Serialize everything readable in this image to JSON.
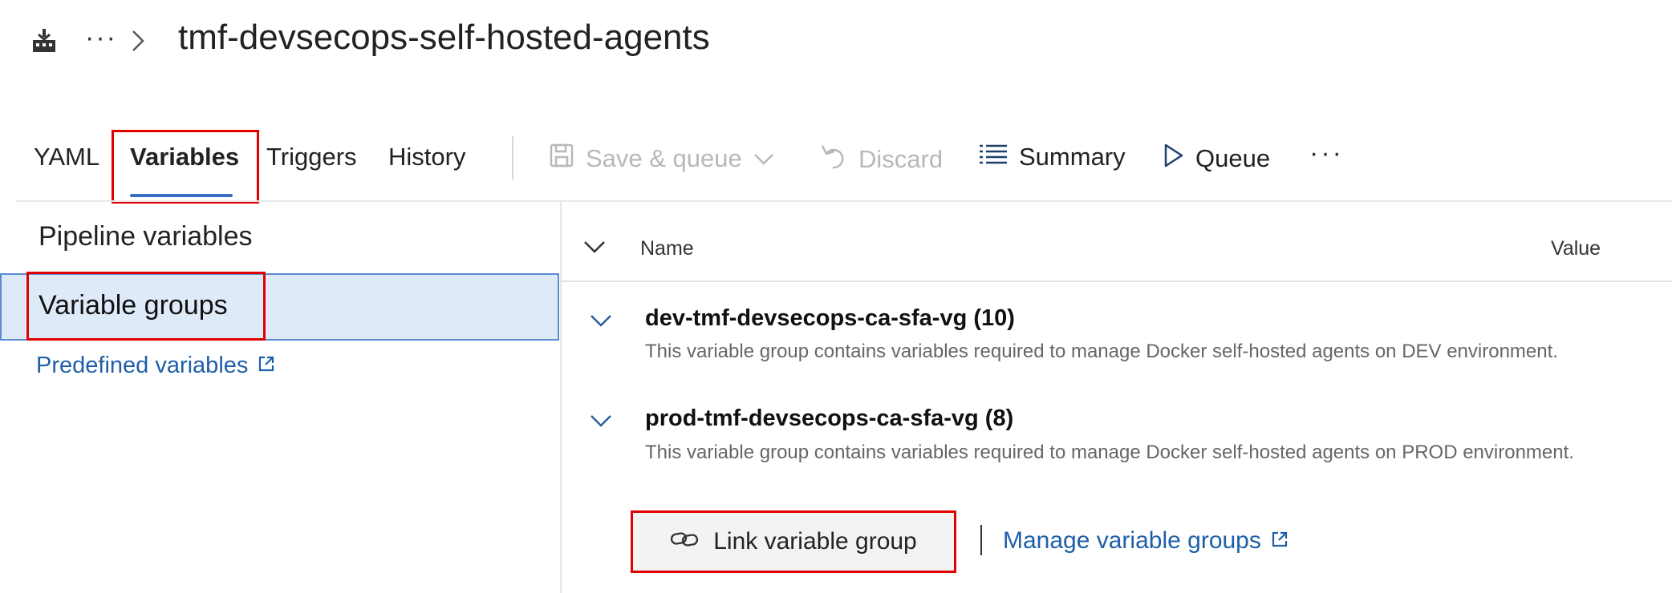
{
  "header": {
    "more_label": "···",
    "title": "tmf-devsecops-self-hosted-agents"
  },
  "tabs": [
    {
      "label": "YAML"
    },
    {
      "label": "Variables"
    },
    {
      "label": "Triggers"
    },
    {
      "label": "History"
    }
  ],
  "toolbar": {
    "save_queue": "Save & queue",
    "discard": "Discard",
    "summary": "Summary",
    "queue": "Queue",
    "more": "···"
  },
  "sidebar": {
    "items": [
      {
        "label": "Pipeline variables"
      },
      {
        "label": "Variable groups"
      },
      {
        "label": "Predefined variables"
      }
    ]
  },
  "table": {
    "col_name": "Name",
    "col_value": "Value"
  },
  "groups": [
    {
      "title": "dev-tmf-devsecops-ca-sfa-vg (10)",
      "description": "This variable group contains variables required to manage Docker self-hosted agents on DEV environment."
    },
    {
      "title": "prod-tmf-devsecops-ca-sfa-vg (8)",
      "description": "This variable group contains variables required to manage Docker self-hosted agents on PROD environment."
    }
  ],
  "actions": {
    "link_group": "Link variable group",
    "manage_groups": "Manage variable groups"
  },
  "icons": {
    "pipeline": "pipeline-icon",
    "breadcrumb_chevron": "chevron-right-icon",
    "save": "save-icon",
    "dropdown": "chevron-down-icon",
    "discard": "undo-icon",
    "summary": "list-icon",
    "queue": "play-icon",
    "external": "external-link-icon",
    "link": "link-icon"
  },
  "colors": {
    "accent": "#3a6fc6",
    "link": "#1f5fa8",
    "selected_bg": "#deeaf7",
    "highlight_border": "#e00000"
  }
}
